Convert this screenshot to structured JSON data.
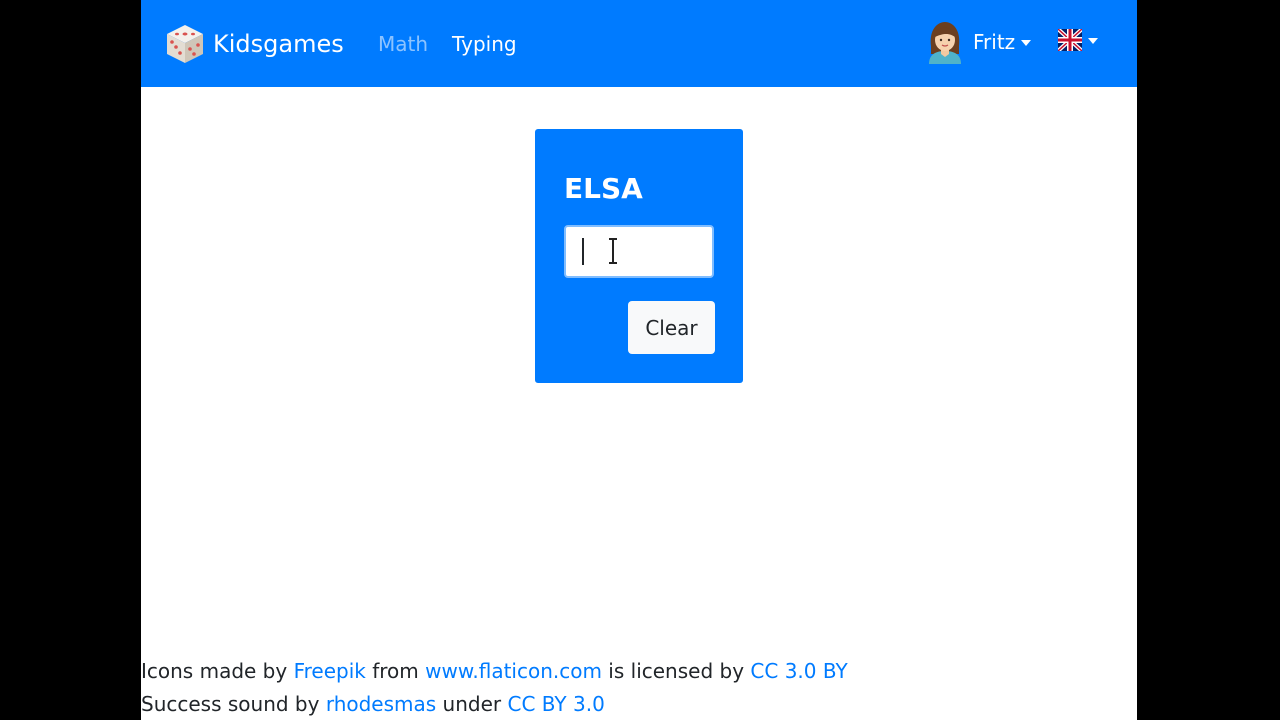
{
  "navbar": {
    "brand_icon": "dice-icon",
    "brand": "Kidsgames",
    "links": [
      {
        "label": "Math",
        "active": false
      },
      {
        "label": "Typing",
        "active": true
      }
    ],
    "user": {
      "avatar_icon": "girl-avatar-icon",
      "name": "Fritz"
    },
    "language": {
      "flag_icon": "uk-flag-icon"
    }
  },
  "game": {
    "word": "ELSA",
    "input_value": "",
    "clear_label": "Clear"
  },
  "footer": {
    "line1": {
      "prefix": "Icons made by ",
      "author": "Freepik",
      "from": " from ",
      "site": "www.flaticon.com",
      "licensed": " is licensed by ",
      "license": "CC 3.0 BY"
    },
    "line2": {
      "prefix": "Success sound by ",
      "author": "rhodesmas",
      "under": " under ",
      "license": "CC BY 3.0"
    }
  },
  "colors": {
    "primary": "#007bff",
    "nav_inactive": "rgba(255,255,255,0.55)",
    "button_bg": "#f8f9fa",
    "outside": "#000000"
  }
}
